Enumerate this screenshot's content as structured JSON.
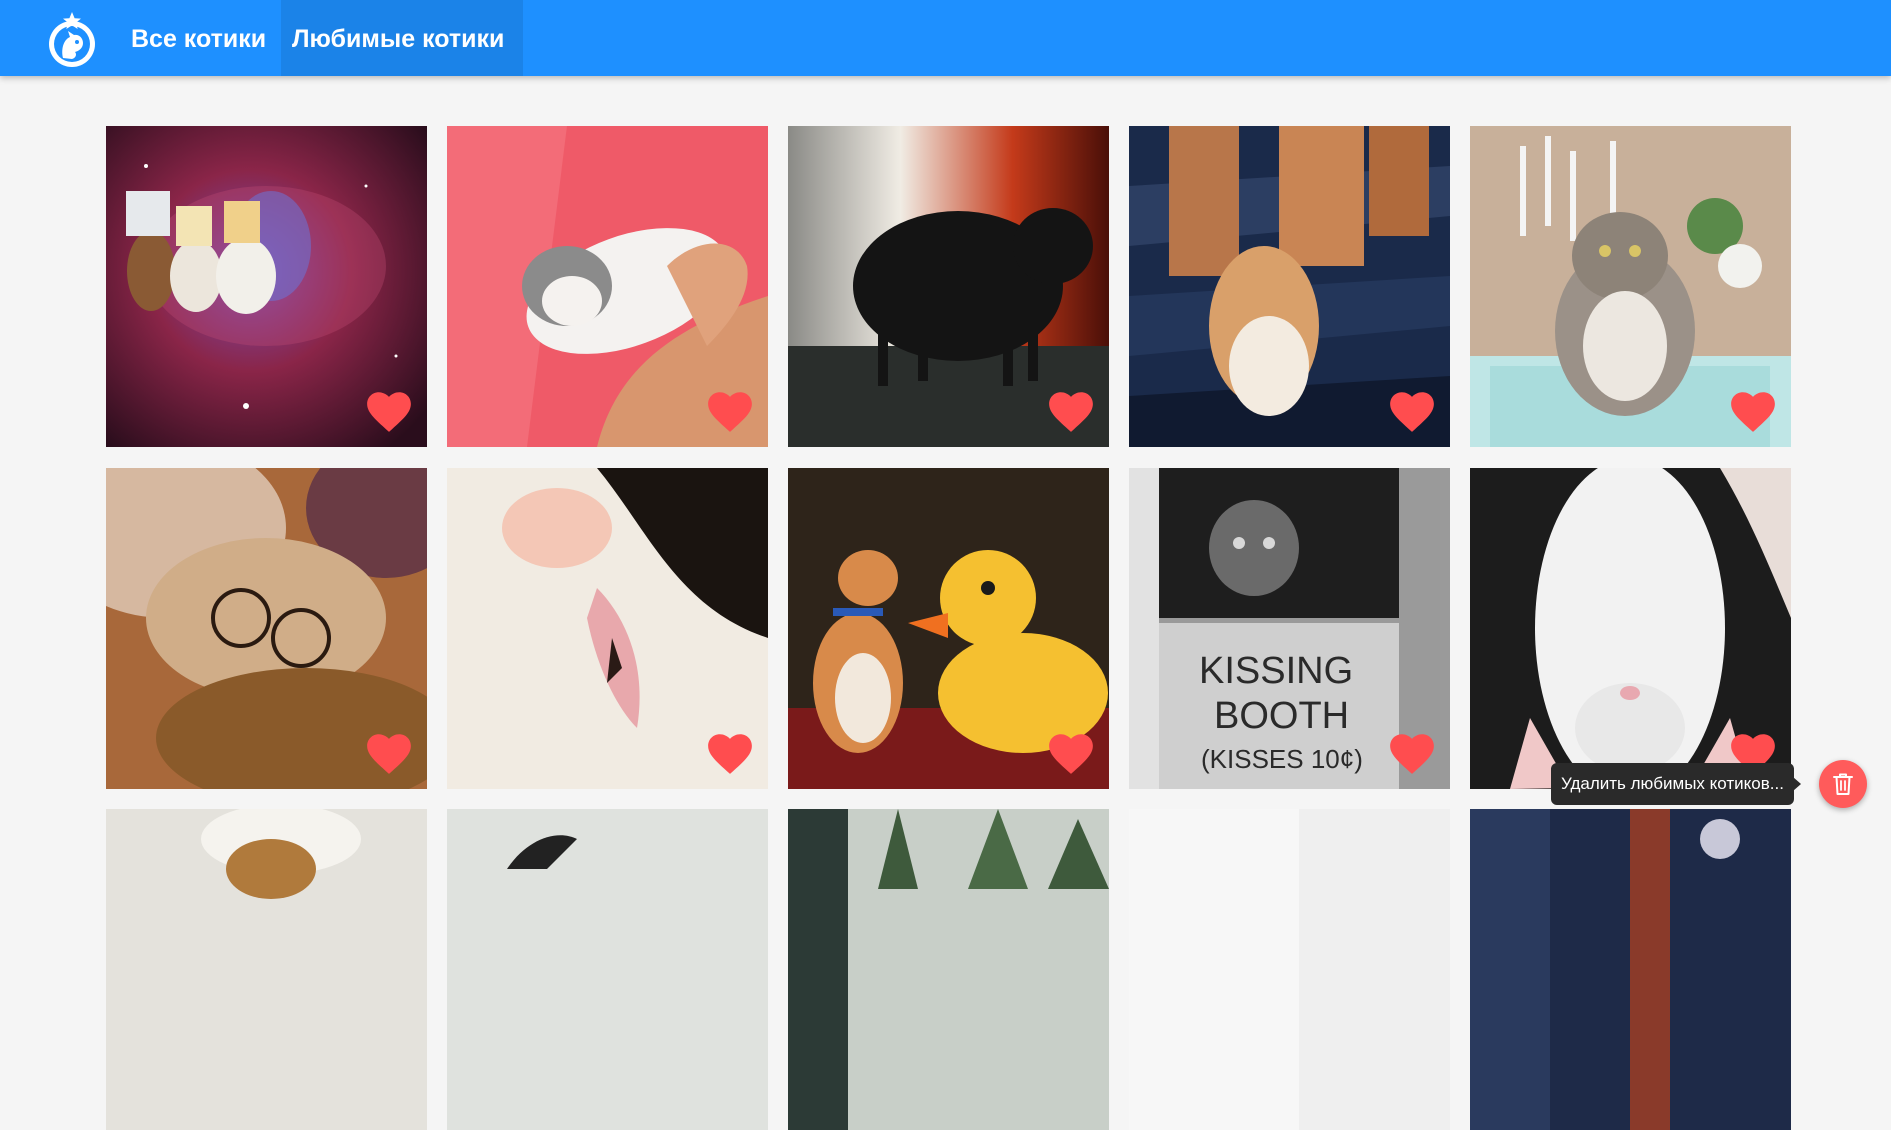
{
  "nav": {
    "logo_icon": "cat-star-logo-icon",
    "all_label": "Все котики",
    "favorites_label": "Любимые котики"
  },
  "colors": {
    "header": "#1e90ff",
    "heart": "#ff4d4f",
    "fab": "#ff5b5b",
    "background": "#f5f5f5"
  },
  "cards": [
    {
      "subject": "cats-with-noodle-cups-in-space",
      "favorited": true
    },
    {
      "subject": "kitten-sleeping-in-hand",
      "favorited": true
    },
    {
      "subject": "wet-cat-silhouette",
      "favorited": true
    },
    {
      "subject": "ginger-cat-legs-on-stairs",
      "favorited": true
    },
    {
      "subject": "fluffy-grey-cat-on-table",
      "favorited": true
    },
    {
      "subject": "cat-sleeping-with-glasses",
      "favorited": true
    },
    {
      "subject": "white-cat-yawning-closeup",
      "favorited": true
    },
    {
      "subject": "kitten-and-rubber-duck",
      "favorited": true
    },
    {
      "subject": "cat-in-kissing-booth-box",
      "favorited": true
    },
    {
      "subject": "white-cat-upside-down",
      "favorited": true
    },
    {
      "subject": "cat-with-white-hat",
      "favorited": true
    },
    {
      "subject": "partial-photo",
      "favorited": true
    },
    {
      "subject": "trees-photo",
      "favorited": true
    },
    {
      "subject": "bright-photo",
      "favorited": true
    },
    {
      "subject": "dark-photo",
      "favorited": true
    }
  ],
  "photo_text": {
    "kissing_booth_line1": "KISSING",
    "kissing_booth_line2": "BOOTH",
    "kissing_booth_line3": "(KISSES 10¢)"
  },
  "fab": {
    "icon": "trash-icon",
    "tooltip": "Удалить любимых котиков..."
  }
}
